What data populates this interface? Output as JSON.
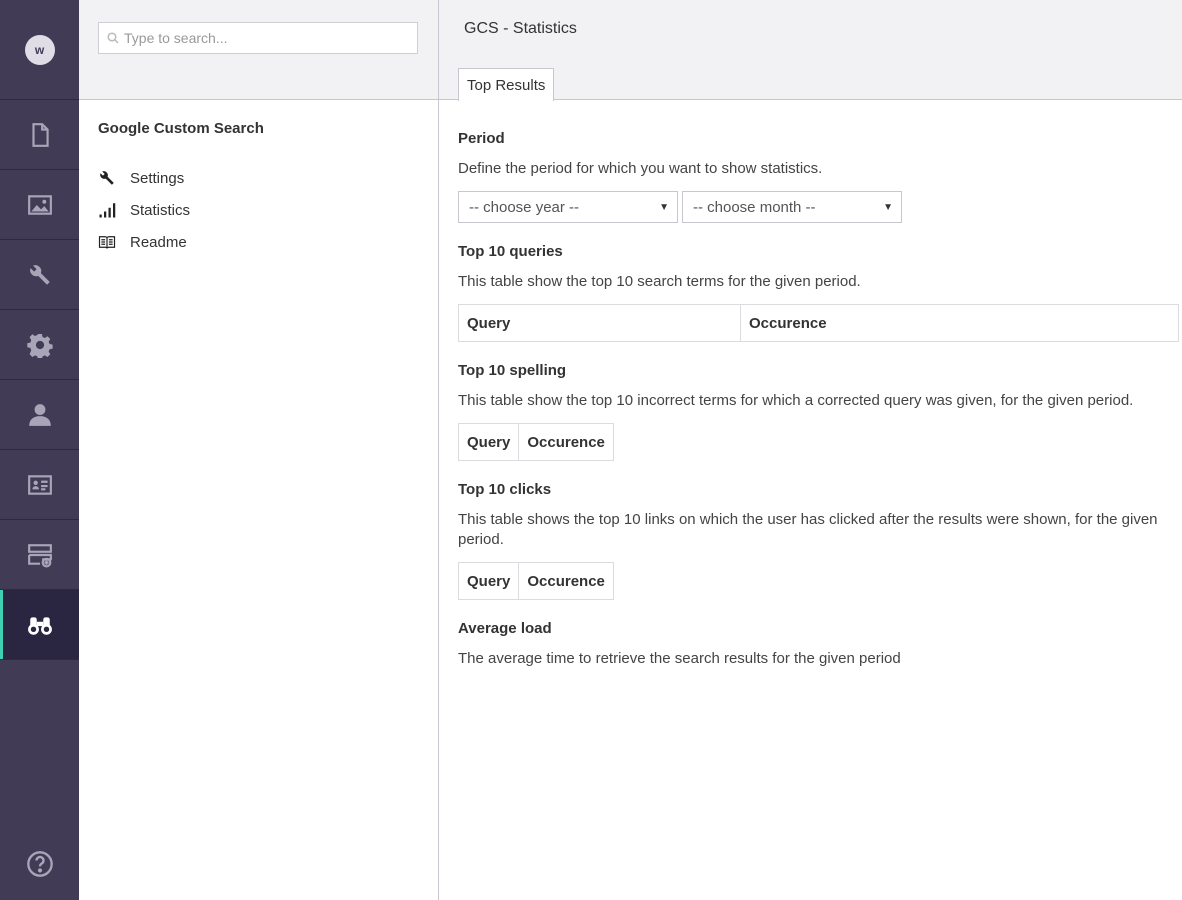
{
  "rail": {
    "avatar_letter": "w",
    "items": [
      {
        "icon": "document-icon"
      },
      {
        "icon": "media-icon"
      },
      {
        "icon": "wrench-icon"
      },
      {
        "icon": "gear-icon"
      },
      {
        "icon": "user-icon"
      },
      {
        "icon": "contact-card-icon"
      },
      {
        "icon": "forms-icon"
      },
      {
        "icon": "binoculars-icon",
        "active": true
      }
    ],
    "help_icon": "help-icon",
    "accent_color": "#3fd1b4",
    "background_color": "#413b55"
  },
  "tree": {
    "search_placeholder": "Type to search...",
    "title": "Google Custom Search",
    "items": [
      {
        "label": "Settings",
        "icon": "wrench-icon"
      },
      {
        "label": "Statistics",
        "icon": "bar-chart-icon"
      },
      {
        "label": "Readme",
        "icon": "book-icon"
      }
    ]
  },
  "main": {
    "title": "GCS - Statistics",
    "tab": "Top Results",
    "period": {
      "title": "Period",
      "desc": "Define the period for which you want to show statistics.",
      "year_select": "-- choose year --",
      "month_select": "-- choose month --"
    },
    "queries": {
      "title": "Top 10 queries",
      "desc": "This table show the top 10 search terms for the given period.",
      "col_query": "Query",
      "col_occurence": "Occurence"
    },
    "spelling": {
      "title": "Top 10 spelling",
      "desc": "This table show the top 10 incorrect terms for which a corrected query was given, for the given period.",
      "col_query": "Query",
      "col_occurence": "Occurence"
    },
    "clicks": {
      "title": "Top 10 clicks",
      "desc": "This table shows the top 10 links on which the user has clicked after the results were shown, for the given period.",
      "col_query": "Query",
      "col_occurence": "Occurence"
    },
    "average": {
      "title": "Average load",
      "desc": "The average time to retrieve the search results for the given period"
    }
  }
}
